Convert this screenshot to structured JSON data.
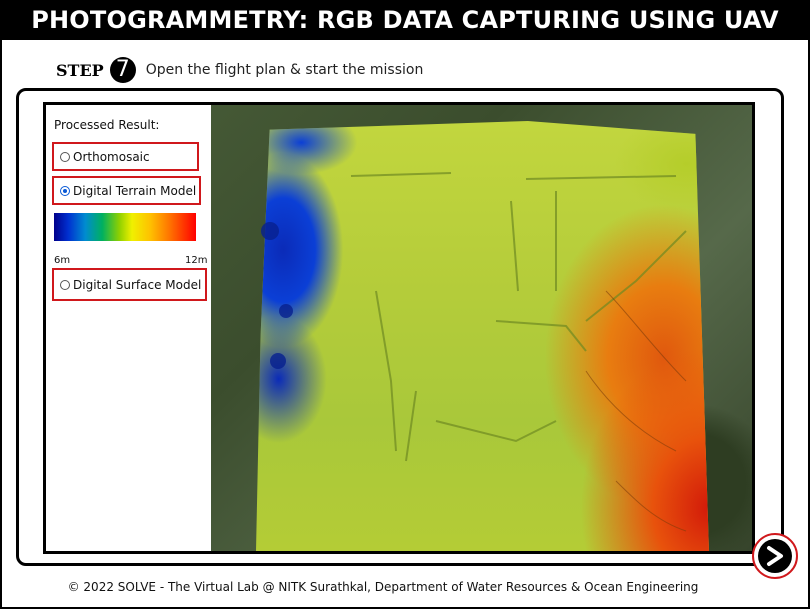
{
  "header": {
    "title": "PHOTOGRAMMETRY: RGB DATA CAPTURING USING UAV"
  },
  "step": {
    "label": "STEP",
    "number": "7",
    "instruction": "Open the flight plan & start the mission"
  },
  "panel": {
    "title": "Processed Result:",
    "options": [
      {
        "label": "Orthomosaic",
        "checked": false
      },
      {
        "label": "Digital Terrain Model",
        "checked": true
      },
      {
        "label": "Digital Surface Model",
        "checked": false
      }
    ],
    "colorbar": {
      "min_label": "6m",
      "max_label": "12m",
      "colors": [
        "#00008b",
        "#008bd0",
        "#8fd000",
        "#f0f000",
        "#ff7000",
        "#ff0000"
      ]
    }
  },
  "navigation": {
    "next_icon": "next-arrow-icon"
  },
  "footer": {
    "text": "© 2022 SOLVE - The Virtual Lab @ NITK Surathkal, Department of Water Resources & Ocean Engineering"
  }
}
